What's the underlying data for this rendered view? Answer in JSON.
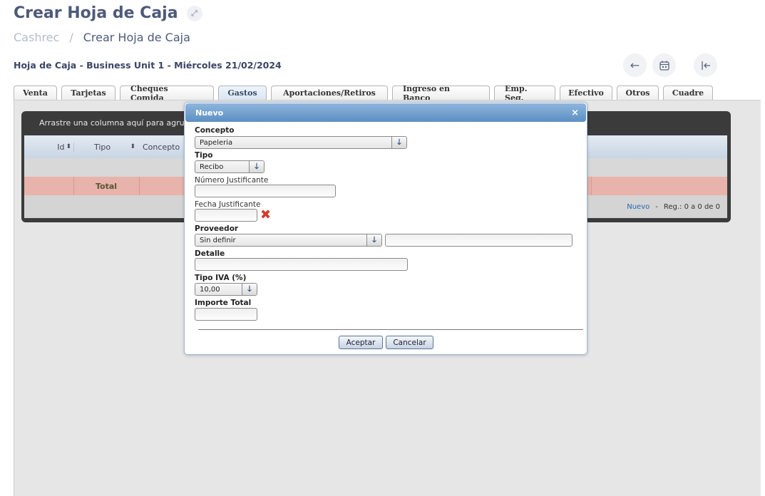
{
  "header": {
    "title": "Crear Hoja de Caja",
    "breadcrumb": {
      "root": "Cashrec",
      "separator": "/",
      "current": "Crear Hoja de Caja"
    },
    "subtitle": "Hoja de Caja - Business Unit 1 - Miércoles 21/02/2024"
  },
  "tabs": [
    {
      "label": "Venta"
    },
    {
      "label": "Tarjetas"
    },
    {
      "label": "Cheques Comida"
    },
    {
      "label": "Gastos",
      "active": true
    },
    {
      "label": "Aportaciones/Retiros"
    },
    {
      "label": "Ingreso en Banco"
    },
    {
      "label": "Emp. Seg."
    },
    {
      "label": "Efectivo"
    },
    {
      "label": "Otros"
    },
    {
      "label": "Cuadre"
    }
  ],
  "grid": {
    "drop_hint": "Arrastre una columna aquí para agrupar",
    "columns": {
      "id": "Id",
      "tipo": "Tipo",
      "concepto": "Concepto"
    },
    "total_label": "Total",
    "footer": {
      "new_link": "Nuevo",
      "dash": "-",
      "records": "Reg.: 0 a 0 de 0"
    }
  },
  "dialog": {
    "title": "Nuevo",
    "close": "×",
    "concepto": {
      "label": "Concepto",
      "value": "Papeleria"
    },
    "tipo": {
      "label": "Tipo",
      "value": "Recibo"
    },
    "numero_justificante": {
      "label": "Número Justificante",
      "value": ""
    },
    "fecha_justificante": {
      "label": "Fecha Justificante",
      "value": ""
    },
    "proveedor": {
      "label": "Proveedor",
      "value": "Sin definir",
      "extra_value": ""
    },
    "detalle": {
      "label": "Detalle",
      "value": ""
    },
    "tipo_iva": {
      "label": "Tipo IVA (%)",
      "value": "10,00"
    },
    "importe_total": {
      "label": "Importe Total",
      "value": ""
    },
    "accept_label": "Aceptar",
    "cancel_label": "Cancelar"
  },
  "colors": {
    "title": "#4d5a7a",
    "dialog_header": "#5c8fc3",
    "total_row": "#e7b3ab",
    "clear_icon": "#d83a2a"
  }
}
